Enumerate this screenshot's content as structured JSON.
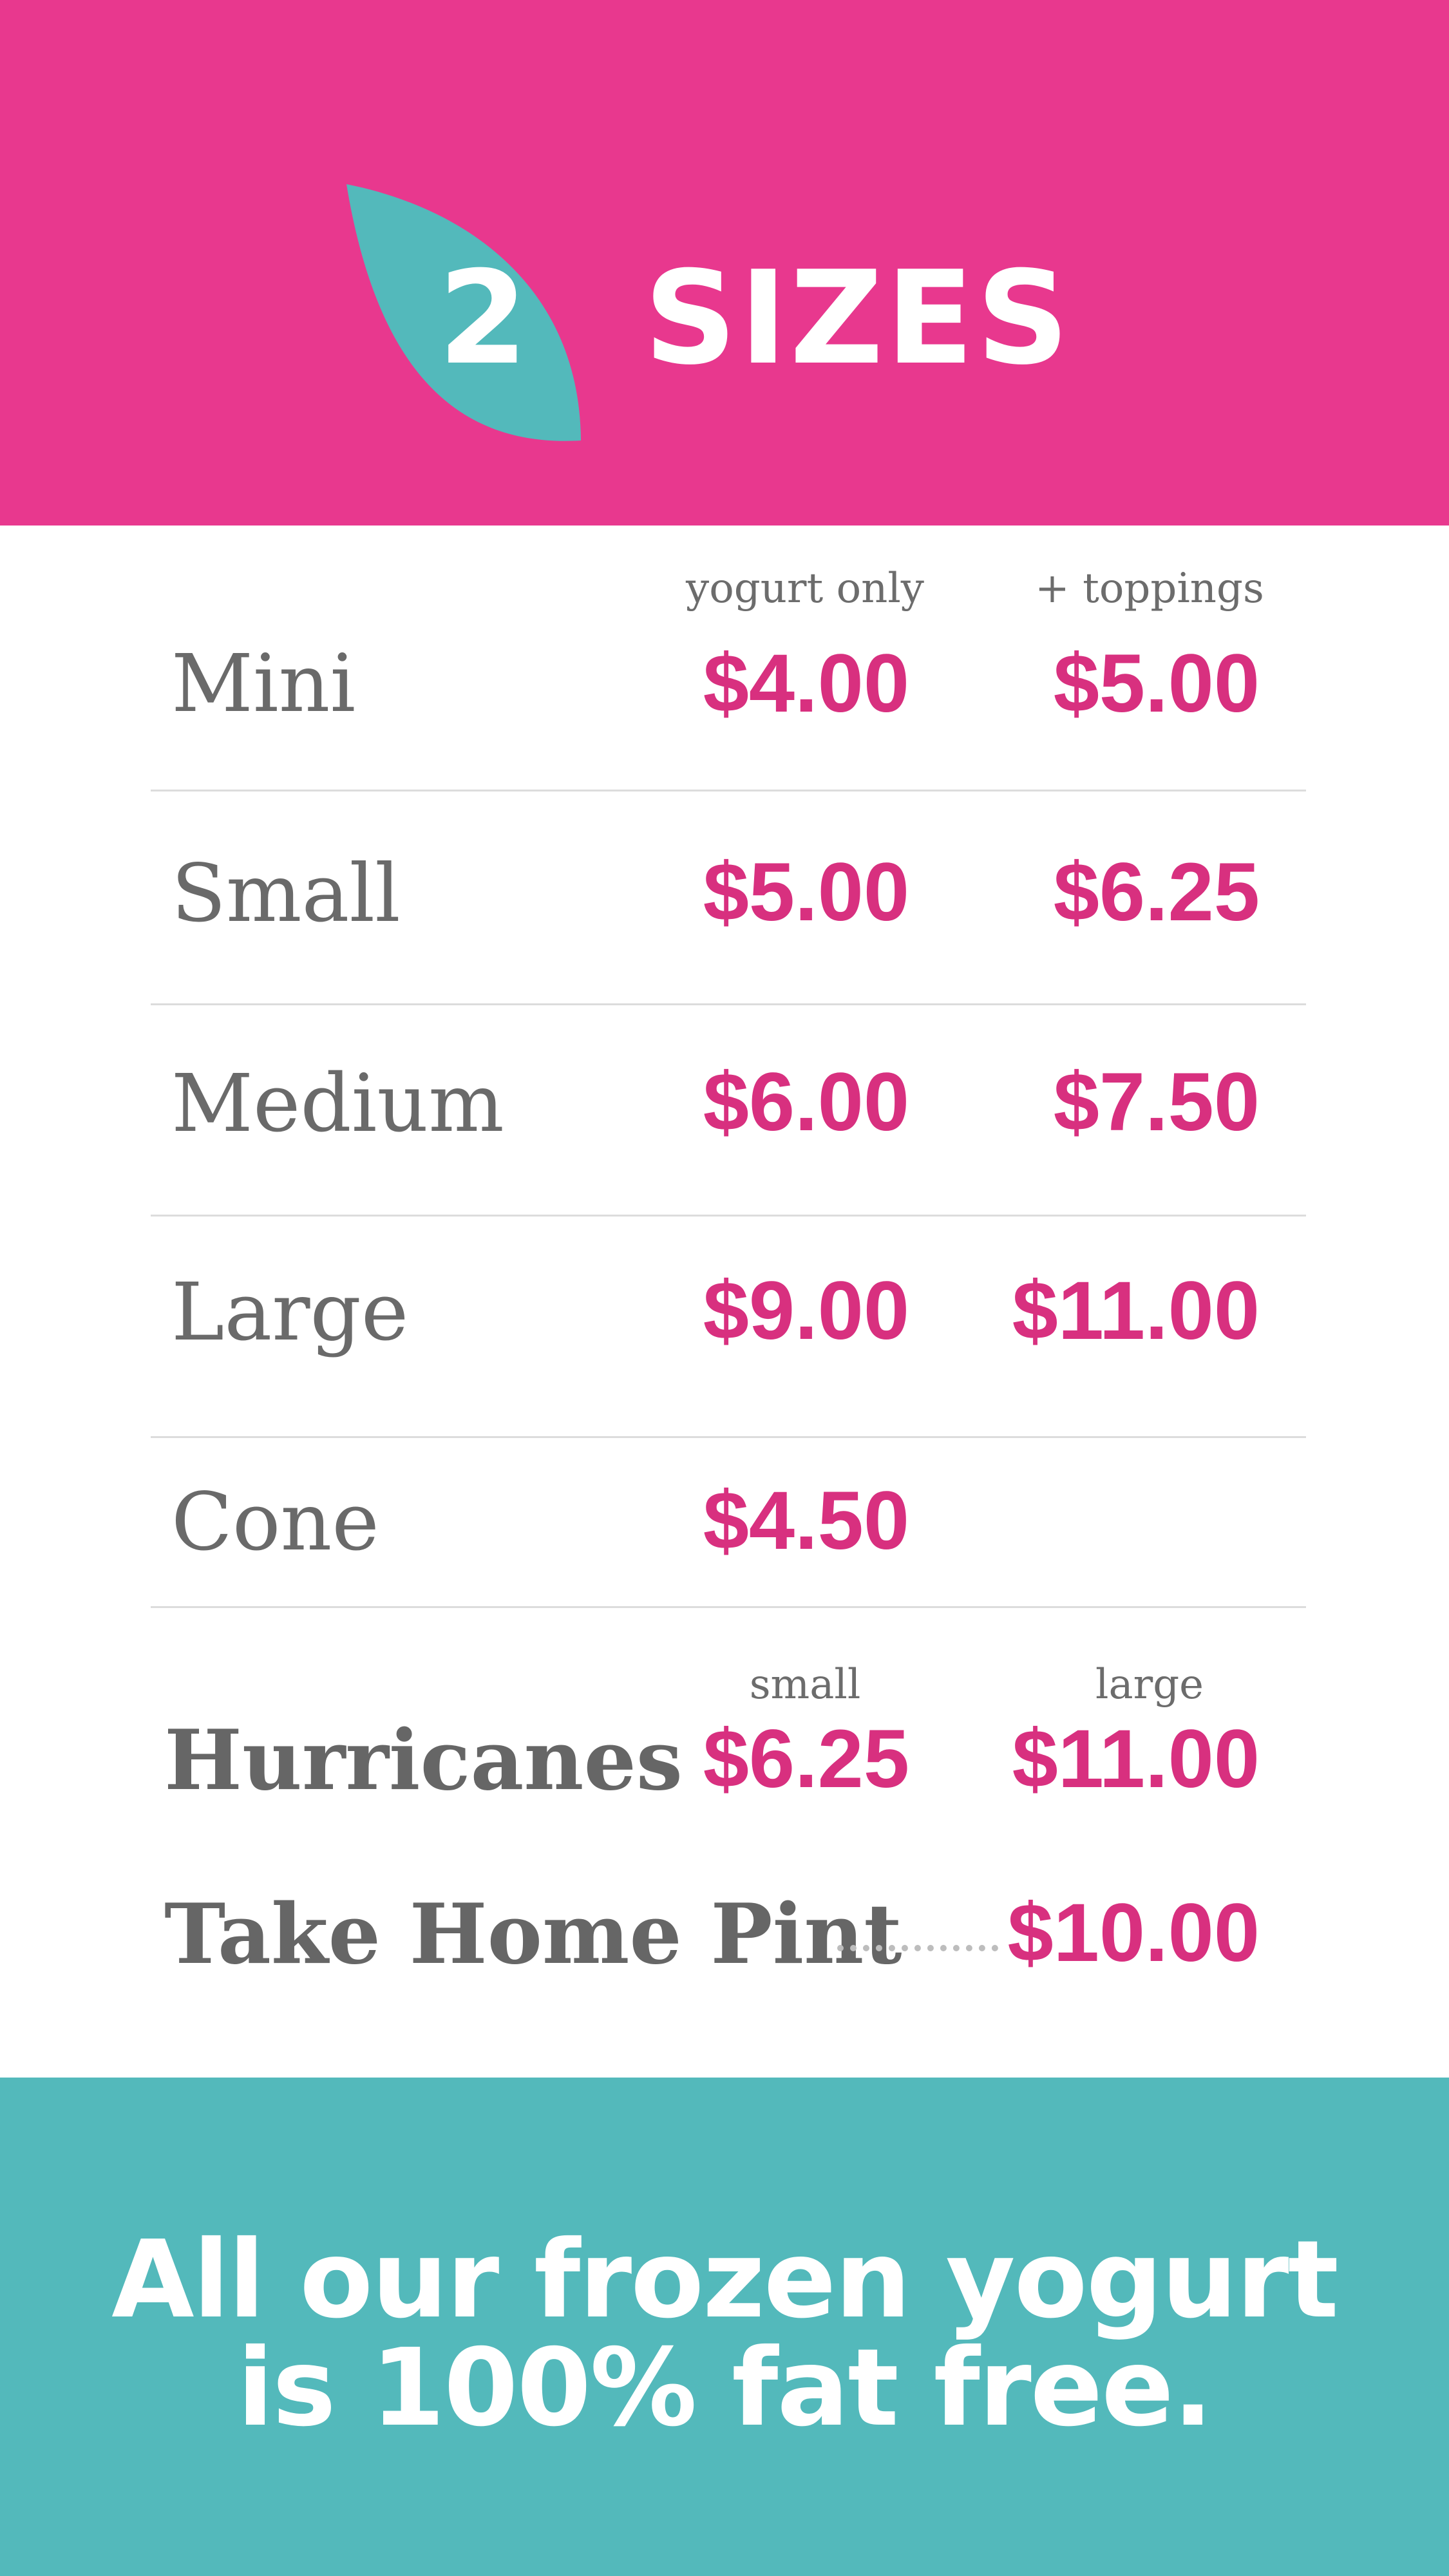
{
  "header": {
    "step_number": "2",
    "title": "SIZES",
    "accent_color": "#53b9bb",
    "background_color": "#e8388e"
  },
  "columns": {
    "yogurt_only": "yogurt only",
    "toppings": "+ toppings"
  },
  "sizes": [
    {
      "name": "Mini",
      "yogurt_only": "$4.00",
      "toppings": "$5.00"
    },
    {
      "name": "Small",
      "yogurt_only": "$5.00",
      "toppings": "$6.25"
    },
    {
      "name": "Medium",
      "yogurt_only": "$6.00",
      "toppings": "$7.50"
    },
    {
      "name": "Large",
      "yogurt_only": "$9.00",
      "toppings": "$11.00"
    },
    {
      "name": "Cone",
      "yogurt_only": "$4.50"
    }
  ],
  "hurricanes": {
    "small_label": "small",
    "large_label": "large",
    "name": "Hurricanes",
    "small_price": "$6.25",
    "large_price": "$11.00"
  },
  "pint": {
    "name": "Take Home Pint",
    "price": "$10.00"
  },
  "footer": {
    "line1": "All our frozen yogurt",
    "line2": "is 100% fat free."
  }
}
